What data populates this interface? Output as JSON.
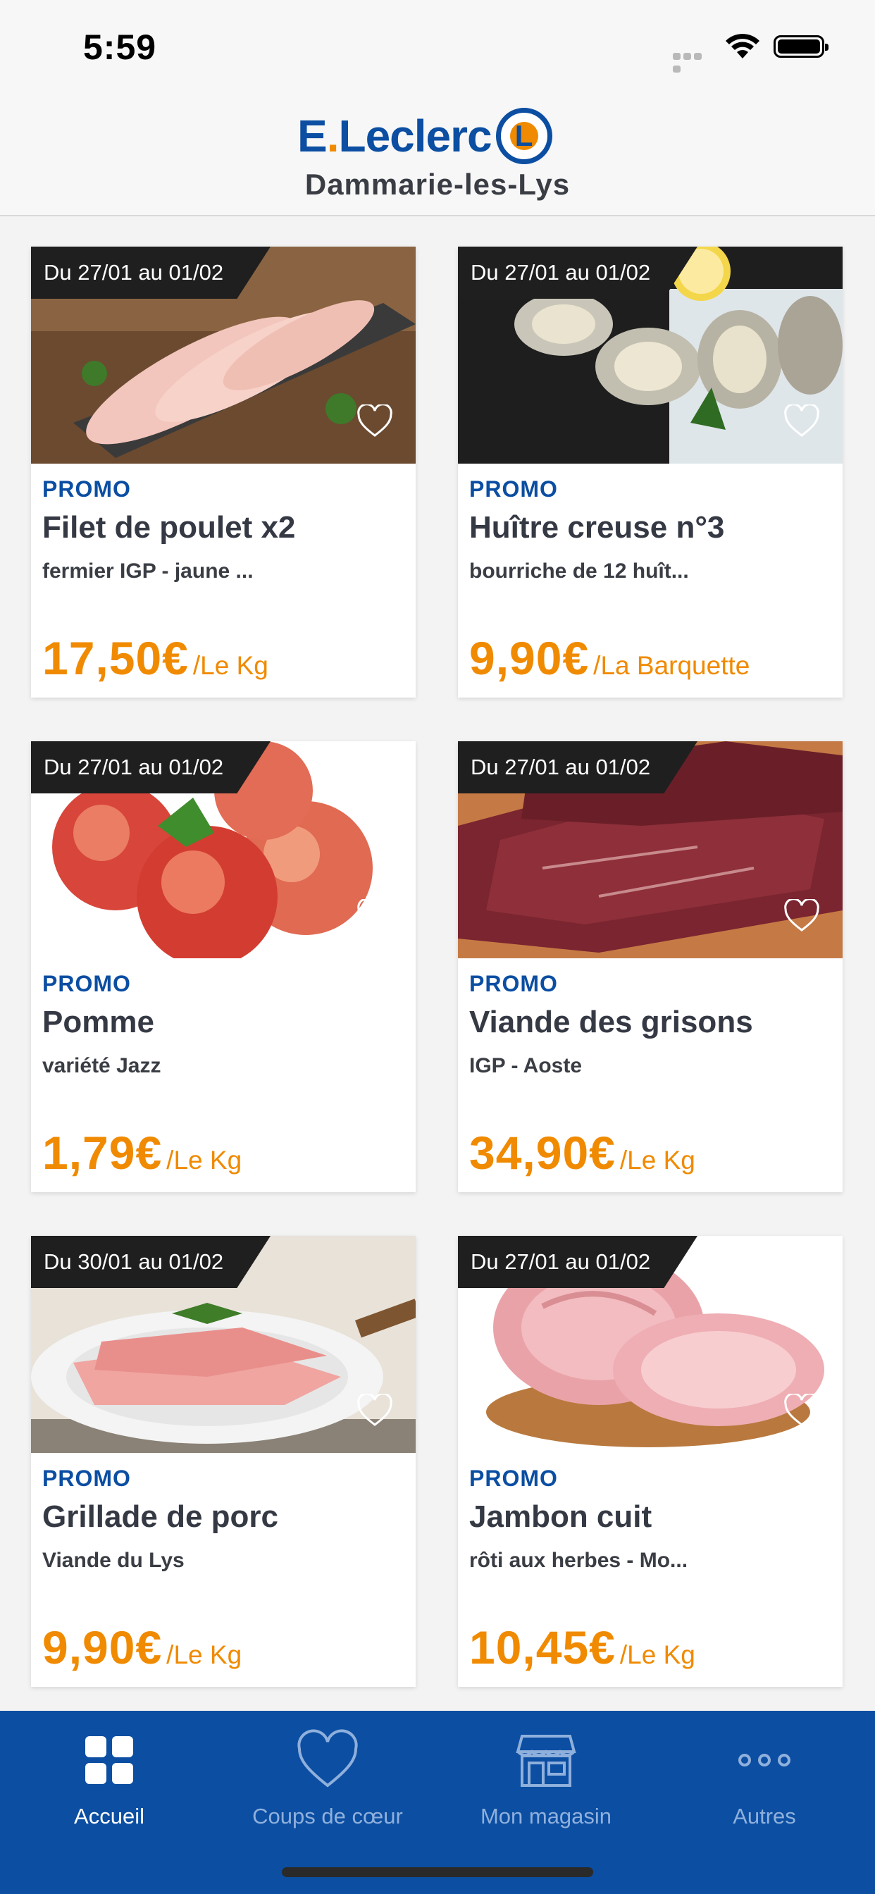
{
  "status_bar": {
    "time": "5:59"
  },
  "header": {
    "logo": {
      "brand_prefix": "E",
      "brand_dot": ".",
      "brand_name": "Leclerc",
      "emblem_letter": "L"
    },
    "store_name": "Dammarie-les-Lys"
  },
  "products": [
    {
      "date_range": "Du 27/01 au 01/02",
      "badge": "PROMO",
      "title": "Filet de poulet x2",
      "subtitle": "fermier IGP - jaune ...",
      "price": "17,50€",
      "unit": "/Le Kg",
      "image": "chicken-fillets"
    },
    {
      "date_range": "Du 27/01 au 01/02",
      "badge": "PROMO",
      "title": "Huître creuse n°3",
      "subtitle": "bourriche de 12 huît...",
      "price": "9,90€",
      "unit": "/La Barquette",
      "image": "oysters"
    },
    {
      "date_range": "Du 27/01 au 01/02",
      "badge": "PROMO",
      "title": "Pomme",
      "subtitle": "variété Jazz",
      "price": "1,79€",
      "unit": "/Le Kg",
      "image": "apples"
    },
    {
      "date_range": "Du 27/01 au 01/02",
      "badge": "PROMO",
      "title": "Viande des grisons",
      "subtitle": "IGP - Aoste",
      "price": "34,90€",
      "unit": "/Le Kg",
      "image": "dried-beef"
    },
    {
      "date_range": "Du 30/01 au 01/02",
      "badge": "PROMO",
      "title": "Grillade de porc",
      "subtitle": "Viande du Lys",
      "price": "9,90€",
      "unit": "/Le Kg",
      "image": "pork-slices"
    },
    {
      "date_range": "Du 27/01 au 01/02",
      "badge": "PROMO",
      "title": "Jambon cuit",
      "subtitle": "rôti aux herbes - Mo...",
      "price": "10,45€",
      "unit": "/Le Kg",
      "image": "ham"
    }
  ],
  "nav": {
    "items": [
      {
        "label": "Accueil",
        "icon": "grid-icon",
        "active": true
      },
      {
        "label": "Coups de cœur",
        "icon": "heart-icon",
        "active": false
      },
      {
        "label": "Mon magasin",
        "icon": "store-icon",
        "active": false
      },
      {
        "label": "Autres",
        "icon": "more-icon",
        "active": false
      }
    ]
  },
  "colors": {
    "brand_blue": "#0b4ea2",
    "price_orange": "#f08a00",
    "badge_dark": "#1f1f1f"
  }
}
